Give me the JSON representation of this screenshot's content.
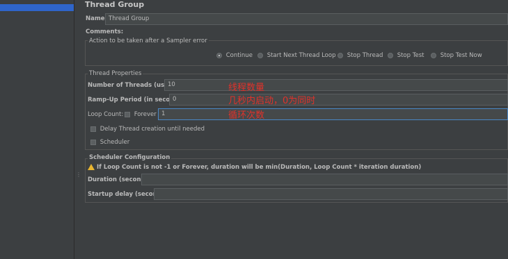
{
  "panel": {
    "title": "Thread Group"
  },
  "name_row": {
    "label": "Name:",
    "value": "Thread Group"
  },
  "comments": {
    "label": "Comments:"
  },
  "sampler_error": {
    "legend": "Action to be taken after a Sampler error",
    "options": [
      "Continue",
      "Start Next Thread Loop",
      "Stop Thread",
      "Stop Test",
      "Stop Test Now"
    ],
    "selected": "Continue"
  },
  "thread_props": {
    "legend": "Thread Properties",
    "threads_label": "Number of Threads (users):",
    "threads_value": "10",
    "threads_note": "线程数量",
    "rampup_label": "Ramp-Up Period (in seconds):",
    "rampup_value": "0",
    "rampup_note": "几秒内启动，0为同时",
    "loop_label": "Loop Count:",
    "forever_label": "Forever",
    "loop_value": "1",
    "loop_note": "循环次数",
    "delay_label": "Delay Thread creation until needed",
    "scheduler_label": "Scheduler"
  },
  "scheduler_config": {
    "legend": "Scheduler Configuration",
    "warning": "If Loop Count is not -1 or Forever, duration will be min(Duration, Loop Count * iteration duration)",
    "duration_label": "Duration (seconds)",
    "startup_label": "Startup delay (seconds)"
  },
  "icons": {
    "warning": "warning-icon",
    "splitter": "grip-icon"
  }
}
